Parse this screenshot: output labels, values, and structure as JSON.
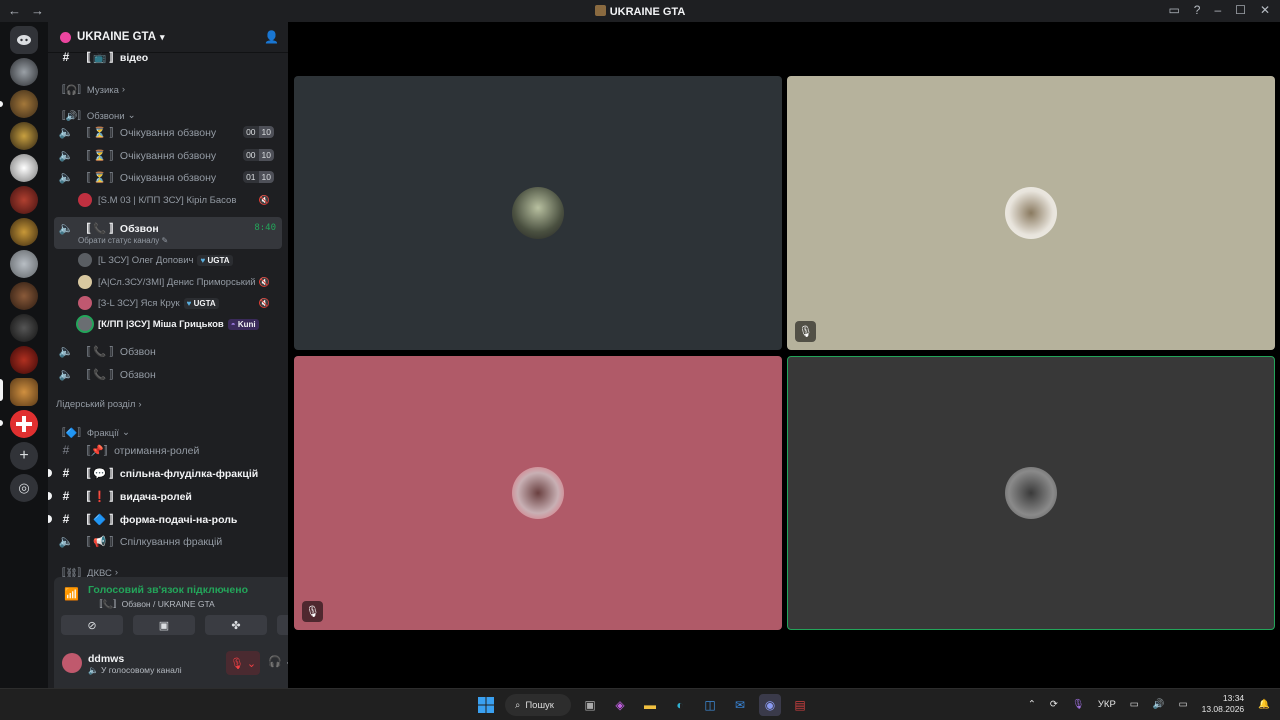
{
  "window": {
    "title": "UKRAINE GTA",
    "back": "←",
    "forward": "→"
  },
  "server": {
    "name": "UKRAINE GTA"
  },
  "channels": {
    "video": "〚 📺 〛відео",
    "cat_music": "〚🎧〛Музика",
    "cat_obzvony": "〚🔊〛Обзвони",
    "wait1": "〚 ⏳ 〛Очікування обзвону",
    "wait1_a": "00",
    "wait1_b": "10",
    "wait2": "〚 ⏳ 〛Очікування обзвону",
    "wait2_a": "00",
    "wait2_b": "10",
    "wait3": "〚 ⏳ 〛Очікування обзвону",
    "wait3_a": "01",
    "wait3_b": "10",
    "wait3_user": "[S.M 03 | К/ПП ЗСУ] Кіріл Басов",
    "active": "〚 📞 〛Обзвон",
    "active_time": "8:40",
    "active_status": "Обрати статус каналу",
    "u1": "[L ЗСУ] Олег Допович",
    "u1_badge": "UGTA",
    "u2": "[А|Сл.ЗСУ/ЗМІ] Денис Приморський",
    "u3": "[З-L ЗСУ] Яся Крук",
    "u3_badge": "UGTA",
    "u4": "[К/ПП |ЗСУ] Міша Грицьков",
    "u4_badge": "Kuni",
    "obz2": "〚 📞 〛Обзвон",
    "obz3": "〚 📞 〛Обзвон",
    "cat_leaders": "Лідерський розділ",
    "cat_fractions": "〚🔷〛Фракції",
    "roles_get": "〚📌〛отримання-ролей",
    "flood": "〚 💬 〛спільна-флуділка-фракцій",
    "roles_give": "〚 ❗ 〛видача-ролей",
    "form": "〚 🔷 〛форма-подачі-на-роль",
    "talk": "〚 📢 〛Спілкування фракцій",
    "cat_dkvs": "〚⛓〛ДКВС"
  },
  "voice": {
    "status": "Голосовий зв'язок підключено",
    "location": "〚📞〛Обзвон / UKRAINE GTA",
    "user": "ddmws",
    "user_status": "У голосовому каналі"
  },
  "taskbar": {
    "search": "Пошук",
    "lang": "УКР",
    "time": "13:34",
    "date": "13.08.2026"
  }
}
